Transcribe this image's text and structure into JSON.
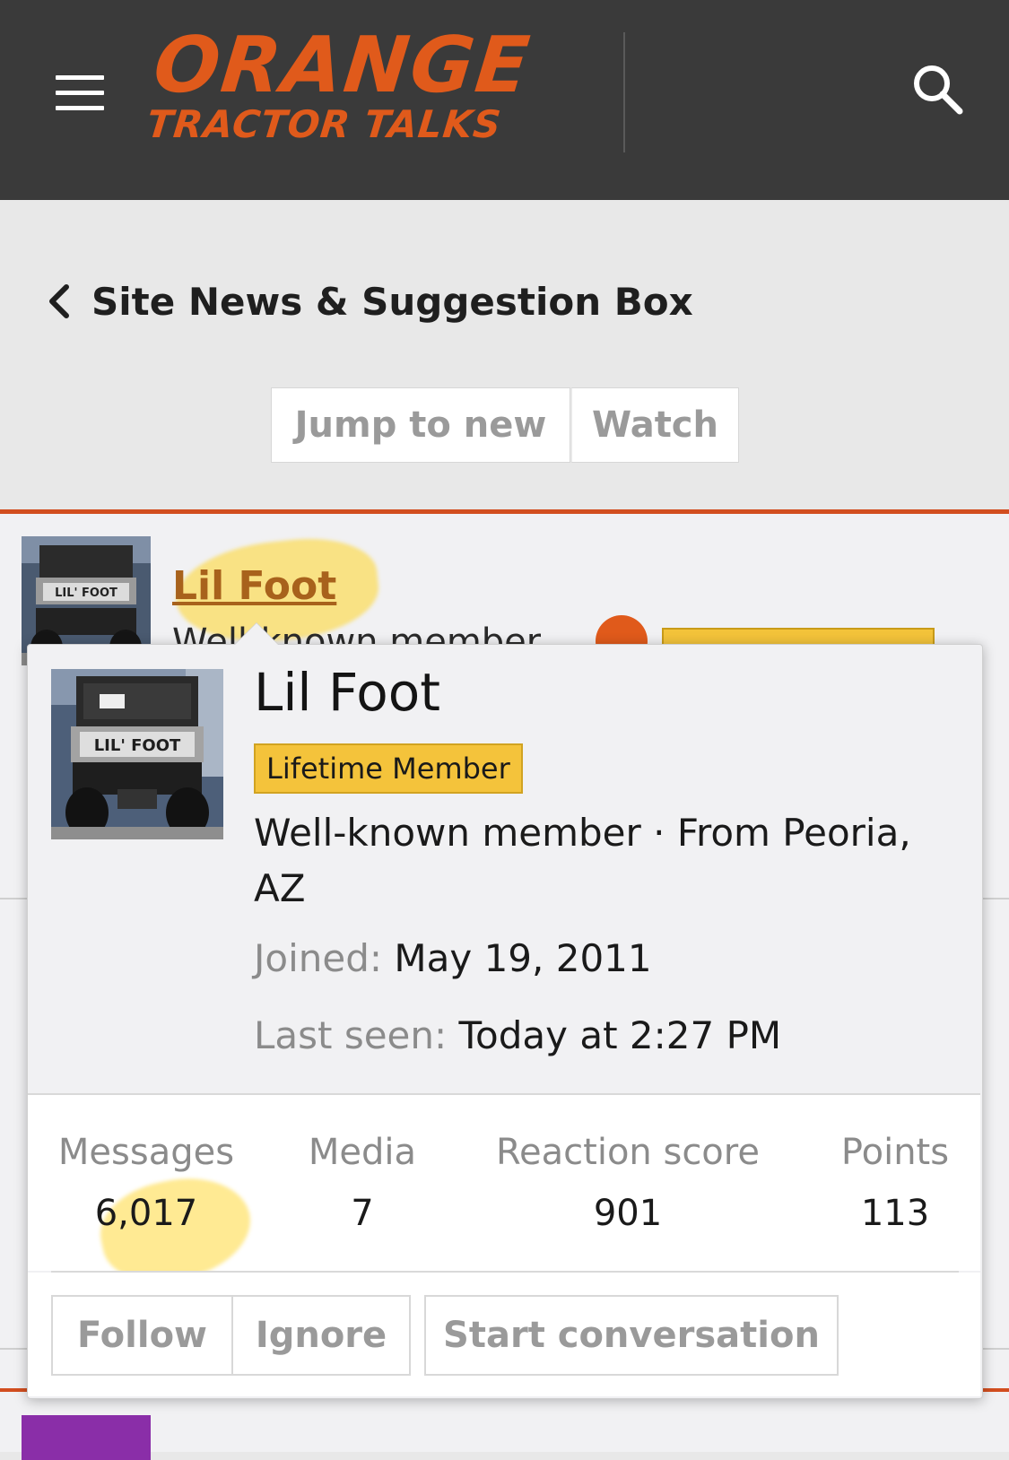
{
  "header": {
    "logo_top": "ORANGE",
    "logo_bottom": "TRACTOR TALKS",
    "brand_color": "#e05a1b",
    "menu_icon": "hamburger-menu-icon",
    "search_icon": "search-icon"
  },
  "breadcrumb": {
    "icon": "chevron-left-icon",
    "label": "Site News & Suggestion Box"
  },
  "toolbar": {
    "jump_label": "Jump to new",
    "watch_label": "Watch"
  },
  "post": {
    "username": "Lil Foot",
    "role_fragment": "Well-known member"
  },
  "member_card": {
    "name": "Lil Foot",
    "badge": "Lifetime Member",
    "title": "Well-known member",
    "separator": "·",
    "location": "From Peoria, AZ",
    "joined_label": "Joined:",
    "joined_value": "May 19, 2011",
    "last_seen_label": "Last seen:",
    "last_seen_value": "Today at 2:27 PM",
    "stats": [
      {
        "label": "Messages",
        "value": "6,017"
      },
      {
        "label": "Media",
        "value": "7"
      },
      {
        "label": "Reaction score",
        "value": "901"
      },
      {
        "label": "Points",
        "value": "113"
      }
    ],
    "actions": {
      "follow": "Follow",
      "ignore": "Ignore",
      "conversation": "Start conversation"
    },
    "badge_color": "#f4c33b"
  }
}
